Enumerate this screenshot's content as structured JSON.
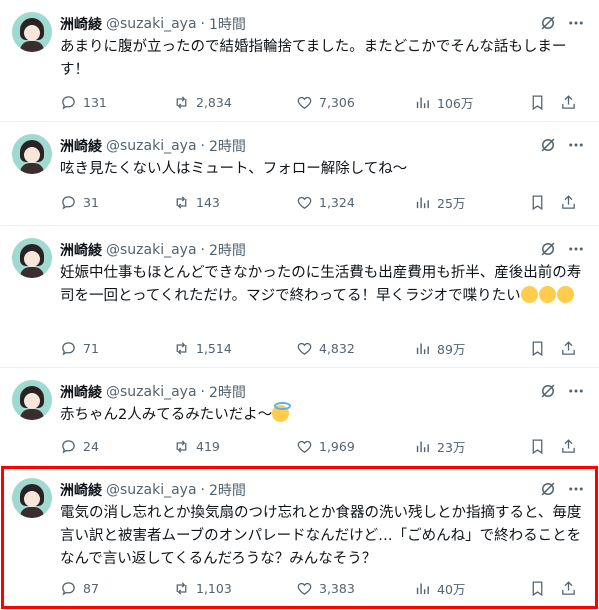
{
  "tweets": [
    {
      "author": "洲崎綾",
      "handle": "@suzaki_aya",
      "time": "1時間",
      "text": "あまりに腹が立ったので結婚指輪捨てました。またどこかでそんな話もしまーす！",
      "emoji": [],
      "replies": "131",
      "retweets": "2,834",
      "likes": "7,306",
      "views": "106万"
    },
    {
      "author": "洲崎綾",
      "handle": "@suzaki_aya",
      "time": "2時間",
      "text": "呟き見たくない人はミュート、フォロー解除してね〜",
      "emoji": [],
      "replies": "31",
      "retweets": "143",
      "likes": "1,324",
      "views": "25万"
    },
    {
      "author": "洲崎綾",
      "handle": "@suzaki_aya",
      "time": "2時間",
      "text": "妊娠中仕事もほとんどできなかったのに生活費も出産費用も折半、産後出前の寿司を一回とってくれただけ。マジで終わってる！早くラジオで喋りたい",
      "emoji": [
        "rofl-emoji",
        "rofl-emoji",
        "rofl-emoji"
      ],
      "replies": "71",
      "retweets": "1,514",
      "likes": "4,832",
      "views": "89万"
    },
    {
      "author": "洲崎綾",
      "handle": "@suzaki_aya",
      "time": "2時間",
      "text": "赤ちゃん2人みてるみたいだよ〜",
      "emoji": [
        "halo-smile-emoji"
      ],
      "replies": "24",
      "retweets": "419",
      "likes": "1,969",
      "views": "23万"
    },
    {
      "author": "洲崎綾",
      "handle": "@suzaki_aya",
      "time": "2時間",
      "text": "電気の消し忘れとか換気扇のつけ忘れとか食器の洗い残しとか指摘すると、毎度言い訳と被害者ムーブのオンパレードなんだけど…「ごめんね」で終わることをなんで言い返してくるんだろうな？みんなそう？",
      "emoji": [],
      "replies": "87",
      "retweets": "1,103",
      "likes": "3,383",
      "views": "40万"
    }
  ],
  "colors": {
    "text": "#0f1419",
    "secondary": "#536471",
    "highlight_border": "#ff0000"
  }
}
